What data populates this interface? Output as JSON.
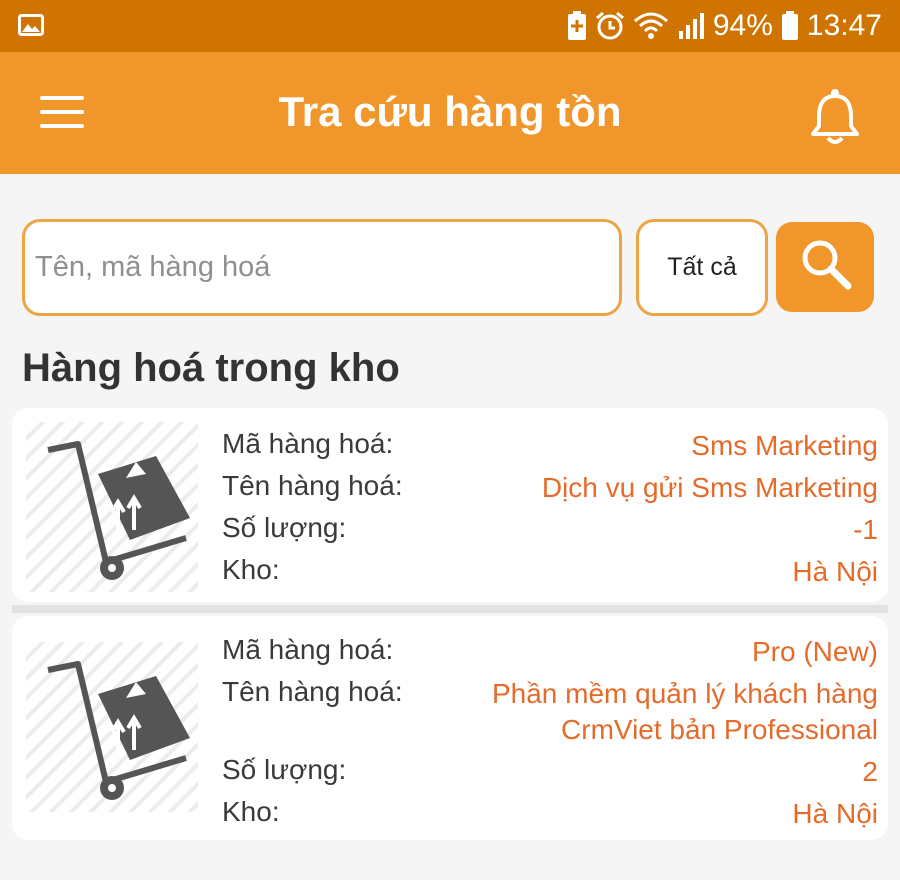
{
  "status_bar": {
    "battery": "94%",
    "time": "13:47",
    "icons": [
      "image-icon",
      "battery-saver-icon",
      "alarm-icon",
      "wifi-icon",
      "signal-icon",
      "battery-icon"
    ]
  },
  "app_bar": {
    "title": "Tra cứu hàng tồn",
    "menu_icon": "hamburger-menu-icon",
    "notification_icon": "bell-icon"
  },
  "search": {
    "placeholder": "Tên, mã hàng hoá",
    "value": "",
    "filter_label": "Tất cả",
    "button_icon": "search-icon"
  },
  "section_title": "Hàng hoá trong kho",
  "labels": {
    "code": "Mã hàng hoá:",
    "name": "Tên hàng hoá:",
    "quantity": "Số lượng:",
    "warehouse": "Kho:"
  },
  "items": [
    {
      "image_icon": "hand-truck-boxes-icon",
      "code": "Sms Marketing",
      "name": "Dịch vụ gửi Sms Marketing",
      "quantity": "-1",
      "warehouse": "Hà Nội"
    },
    {
      "image_icon": "hand-truck-boxes-icon",
      "code": "Pro (New)",
      "name_line1": "Phần mềm quản lý khách hàng",
      "name_line2": "CrmViet bản Professional",
      "quantity": "2",
      "warehouse": "Hà Nội"
    }
  ],
  "colors": {
    "status_bar": "#cf7400",
    "app_bar": "#f0962b",
    "border_accent": "#eda445",
    "value_text": "#e56b2b"
  }
}
